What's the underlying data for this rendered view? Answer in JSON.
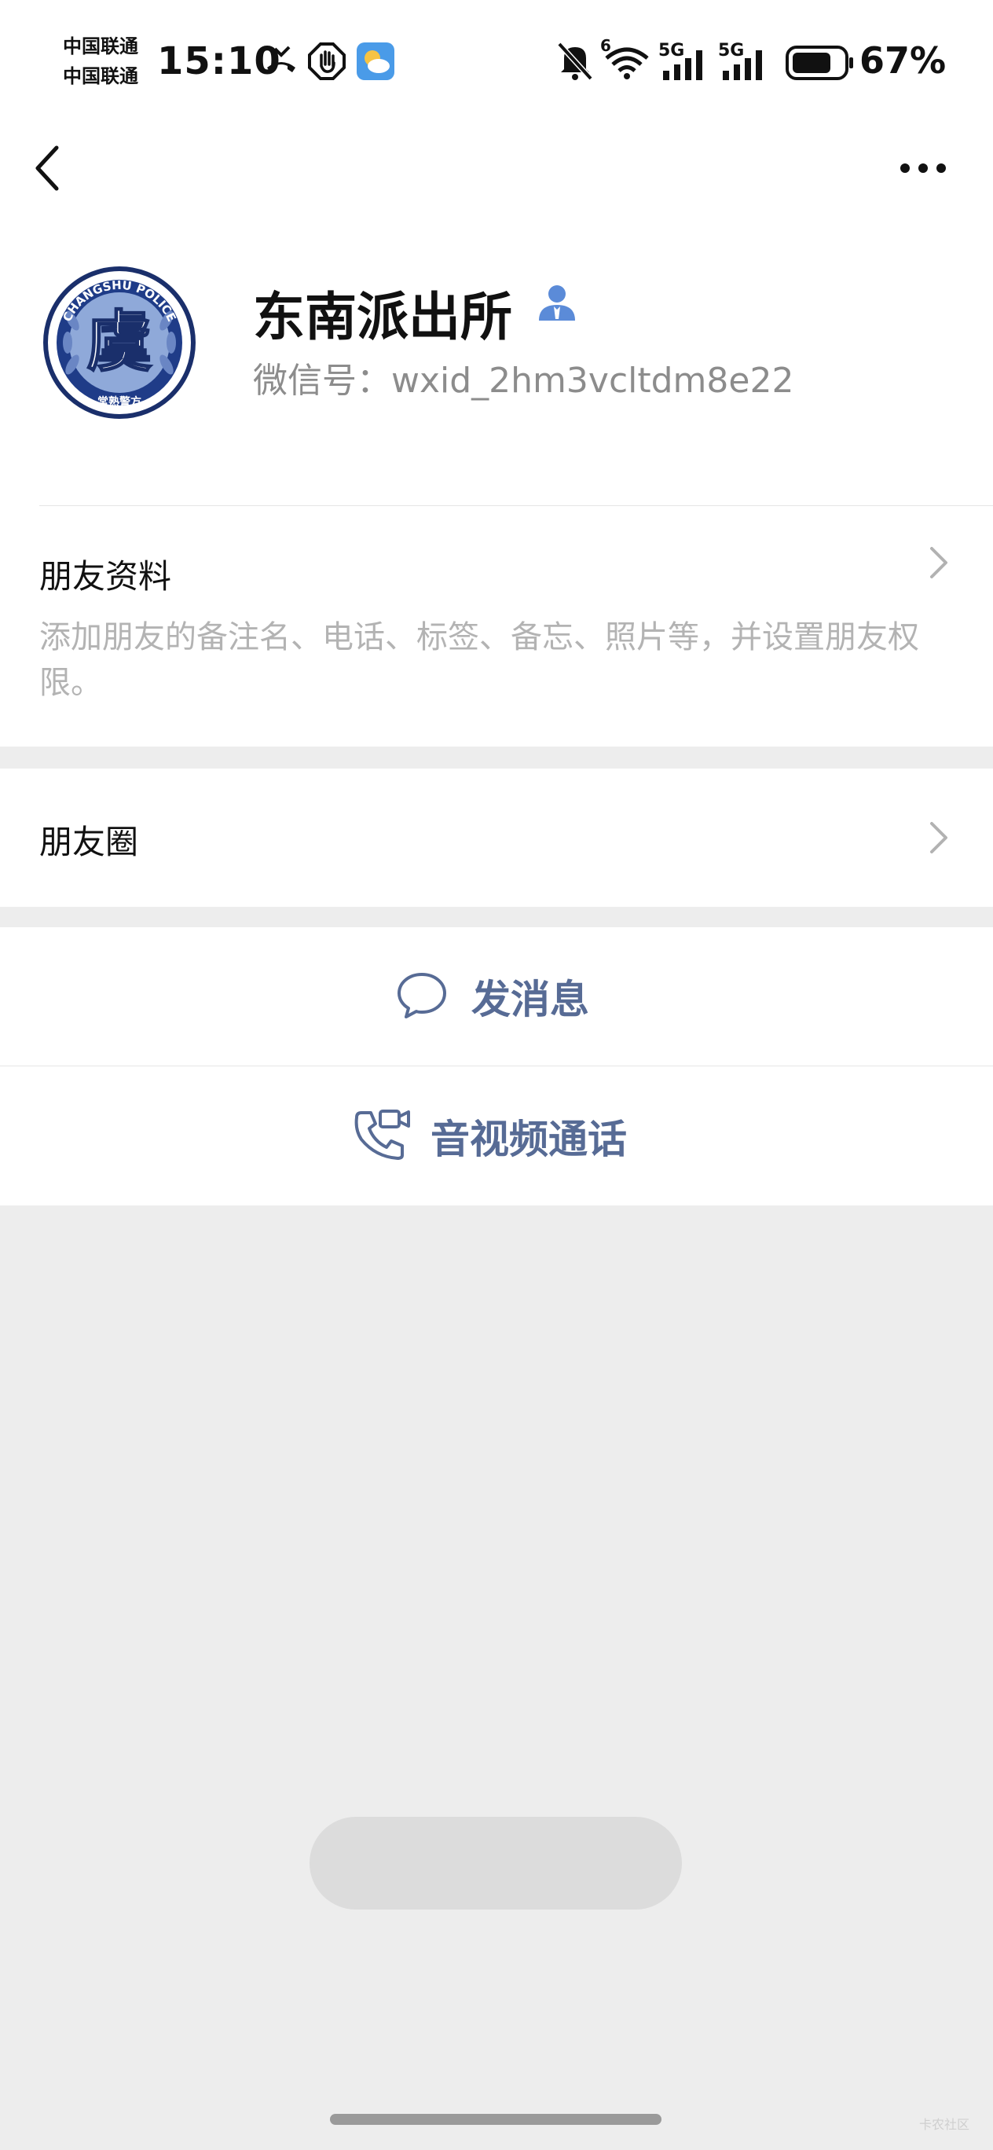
{
  "status_bar": {
    "carrier_1": "中国联通",
    "carrier_2": "中国联通",
    "time": "15:10",
    "network_1": "5G",
    "network_2": "5G",
    "wifi_badge": "6",
    "battery": "67%"
  },
  "header": {
    "back_icon": "chevron-left-icon",
    "more_icon": "more-dots-icon"
  },
  "profile": {
    "name": "东南派出所",
    "wechat_id": "微信号：wxid_2hm3vcltdm8e22",
    "avatar_top_text": "CHANGSHU POLICE",
    "avatar_center_char": "虞",
    "avatar_bottom_text": "常熟警方"
  },
  "friend_info": {
    "title": "朋友资料",
    "description": "添加朋友的备注名、电话、标签、备忘、照片等，并设置朋友权限。"
  },
  "moments": {
    "title": "朋友圈"
  },
  "actions": {
    "message": "发消息",
    "call": "音视频通话"
  },
  "watermark": "卡农社区",
  "colors": {
    "background": "#ededed",
    "link": "#576b95",
    "verified": "#5b8bd8"
  }
}
